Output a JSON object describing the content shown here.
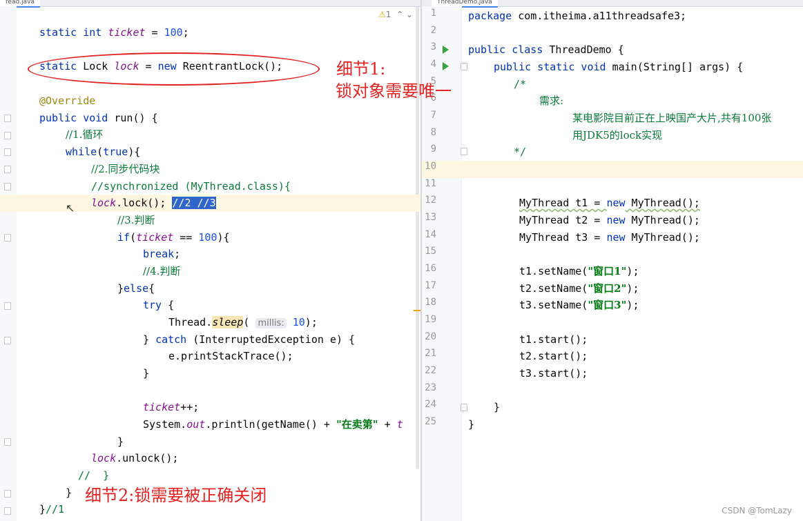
{
  "tabs": {
    "left": "read.java",
    "right": "ThreadDemo.java"
  },
  "warning": {
    "icon": "warning-icon",
    "count": "1"
  },
  "left_code": {
    "l1_kw": "static int ",
    "l1_fld": "ticket",
    "l1_rest": " = ",
    "l1_num": "100",
    "l1_end": ";",
    "l2_kw": "static ",
    "l2_type": "Lock ",
    "l2_fld": "lock",
    "l2_rest": " = ",
    "l2_new": "new",
    "l2_end": " ReentrantLock();",
    "l3": "@Override",
    "l4_kw": "public void ",
    "l4_rest": "run() {",
    "l5": "//1.循环",
    "l6_kw": "while",
    "l6_a": "(",
    "l6_true": "true",
    "l6_b": "){",
    "l7": "//2.同步代码块",
    "l8": "//synchronized (MyThread.class){",
    "l9_fld": "lock",
    "l9_rest": ".lock(); ",
    "l9_sel": "//2 //3",
    "l10": "//3.判断",
    "l11_kw": "if",
    "l11_a": "(",
    "l11_fld": "ticket",
    "l11_b": " == ",
    "l11_num": "100",
    "l11_c": "){",
    "l12_kw": "break",
    "l12_end": ";",
    "l13": "//4.判断",
    "l14_a": "}",
    "l14_kw": "else",
    "l14_b": "{",
    "l15_kw": "try",
    "l15_b": " {",
    "l16_a": "Thread.",
    "l16_m": "sleep",
    "l16_b": "( ",
    "l16_hint": "millis:",
    "l16_num": "10",
    "l16_c": ");",
    "l17_a": "} ",
    "l17_kw": "catch",
    "l17_b": " (InterruptedException e) {",
    "l18": "e.printStackTrace();",
    "l19": "}",
    "l20_fld": "ticket",
    "l20_b": "++;",
    "l21_a": "System.",
    "l21_out": "out",
    "l21_b": ".println(getName() + ",
    "l21_str": "\"在卖第\"",
    "l21_c": " + ",
    "l21_t": "t",
    "l22": "}",
    "l23_fld": "lock",
    "l23_b": ".unlock();",
    "l24": "//  }",
    "l25": "}",
    "l26_a": "}",
    "l26_c": "//1"
  },
  "notes": {
    "note1_line1": "细节1:",
    "note1_line2": "锁对象需要唯一",
    "note2": "细节2:锁需要被正确关闭"
  },
  "right_code": {
    "lines": [
      "1",
      "2",
      "3",
      "4",
      "5",
      "6",
      "7",
      "8",
      "9",
      "10",
      "11",
      "12",
      "13",
      "14",
      "15",
      "16",
      "17",
      "18",
      "19",
      "20",
      "21",
      "22",
      "23",
      "24",
      "25"
    ],
    "r1_kw": "package",
    "r1_b": " com.itheima.a11threadsafe3;",
    "r3_kw": "public class",
    "r3_b": " ThreadDemo {",
    "r4_kw": "public static void",
    "r4_b": " main(String[] args) {",
    "r5": "/*",
    "r6": "需求:",
    "r7": "某电影院目前正在上映国产大片,共有100张",
    "r8": "用JDK5的lock实现",
    "r9": "*/",
    "r12_a": "MyThread t1 = ",
    "r12_kw": "new",
    "r12_b": " MyThread();",
    "r13_a": "MyThread t2 = ",
    "r13_kw": "new",
    "r13_b": " MyThread();",
    "r14_a": "MyThread t3 = ",
    "r14_kw": "new",
    "r14_b": " MyThread();",
    "r16_a": "t1.setName(",
    "r16_s": "\"窗口1\"",
    "r16_b": ");",
    "r17_a": "t2.setName(",
    "r17_s": "\"窗口2\"",
    "r17_b": ");",
    "r18_a": "t3.setName(",
    "r18_s": "\"窗口3\"",
    "r18_b": ");",
    "r20": "t1.start();",
    "r21": "t2.start();",
    "r22": "t3.start();",
    "r24": "}",
    "r25": "}"
  },
  "watermark": "CSDN @TomLazy"
}
